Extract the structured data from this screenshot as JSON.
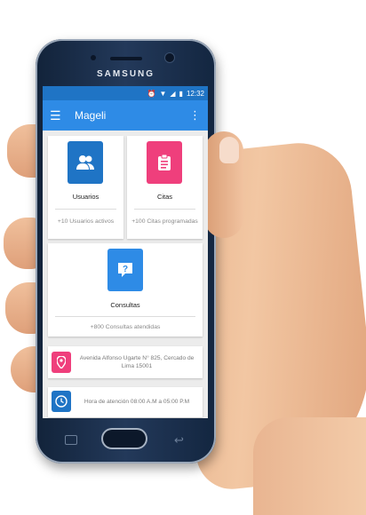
{
  "device": {
    "brand": "SAMSUNG"
  },
  "statusbar": {
    "time": "12:32",
    "icons": [
      "alarm-icon",
      "wifi-icon",
      "signal-icon",
      "battery-icon"
    ]
  },
  "appbar": {
    "title": "Mageli",
    "menu_icon": "hamburger-menu-icon",
    "more_icon": "more-vert-icon"
  },
  "tiles": [
    {
      "label": "Usuarios",
      "subtitle": "+10 Usuarios activos",
      "icon": "users-icon",
      "color": "#1f74c5"
    },
    {
      "label": "Citas",
      "subtitle": "+100 Citas programadas",
      "icon": "clipboard-icon",
      "color": "#ef3f7c"
    },
    {
      "label": "Consultas",
      "subtitle": "+800 Consultas atendidas",
      "icon": "question-chat-icon",
      "color": "#2e8be6"
    }
  ],
  "info": [
    {
      "text": "Avenida Alfonso Ugarte N° 825, Cercado de Lima 15001",
      "icon": "location-pin-icon",
      "color": "#ef3f7c"
    },
    {
      "text": "Hora de atención 08:00 A.M a 05:00 P.M",
      "icon": "clock-icon",
      "color": "#1f74c5"
    }
  ],
  "colors": {
    "appbar": "#2e8be6",
    "statusbar": "#1f74c5",
    "accent_pink": "#ef3f7c",
    "background": "#ececec"
  }
}
